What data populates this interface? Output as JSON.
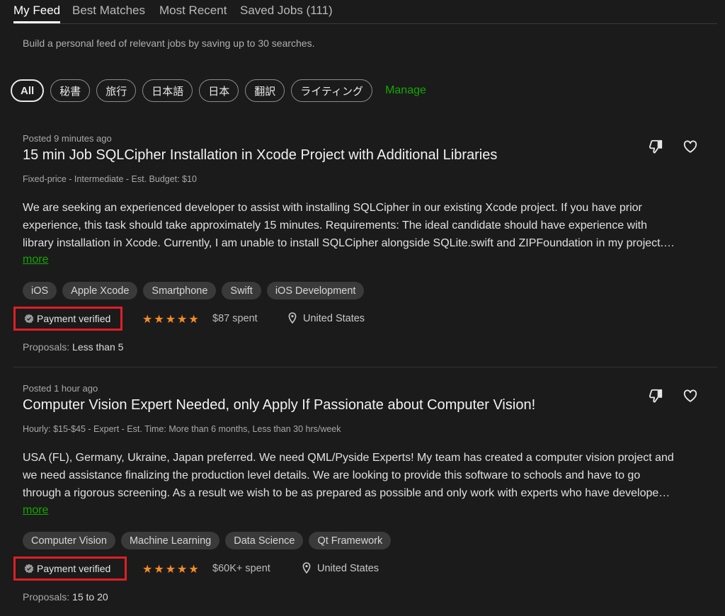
{
  "tabs": [
    {
      "label": "My Feed",
      "active": true
    },
    {
      "label": "Best Matches"
    },
    {
      "label": "Most Recent"
    },
    {
      "label": "Saved Jobs (111)"
    }
  ],
  "feed_hint": "Build a personal feed of relevant jobs by saving up to 30 searches.",
  "filters": {
    "chips": [
      "All",
      "秘書",
      "旅行",
      "日本語",
      "日本",
      "翻訳",
      "ライティング"
    ],
    "manage_label": "Manage"
  },
  "jobs": [
    {
      "posted": "Posted 9 minutes ago",
      "title": "15 min Job SQLCipher Installation in Xcode Project with Additional Libraries",
      "meta": "Fixed-price - Intermediate - Est. Budget: $10",
      "description_lines": [
        "We are seeking an experienced developer to assist with installing SQLCipher in our existing Xcode project. If you have prior",
        "experience, this task should take approximately 15 minutes. Requirements: The ideal candidate should have experience with",
        "library installation in Xcode. Currently, I am unable to install SQLCipher alongside SQLite.swift and ZIPFoundation in my project.…"
      ],
      "more_label": "more",
      "skills": [
        "iOS",
        "Apple Xcode",
        "Smartphone",
        "Swift",
        "iOS Development"
      ],
      "payment": "Payment verified",
      "rating": 5,
      "spent": "$87 spent",
      "location": "United States",
      "proposals_label": "Proposals:",
      "proposals_value": "Less than 5"
    },
    {
      "posted": "Posted 1 hour ago",
      "title": "Computer Vision Expert Needed, only Apply If Passionate about Computer Vision!",
      "meta": "Hourly: $15-$45 - Expert - Est. Time: More than 6 months, Less than 30 hrs/week",
      "description_lines": [
        "USA (FL), Germany, Ukraine, Japan preferred. We need QML/Pyside Experts! My team has created a computer vision project and",
        "we need assistance finalizing the production level details. We are looking to provide this software to schools and have to go",
        "through a rigorous screening. As a result we wish to be as prepared as possible and only work with experts who have develope…"
      ],
      "more_label": "more",
      "skills": [
        "Computer Vision",
        "Machine Learning",
        "Data Science",
        "Qt Framework"
      ],
      "payment": "Payment verified",
      "rating": 5,
      "spent": "$60K+ spent",
      "location": "United States",
      "proposals_label": "Proposals:",
      "proposals_value": "15 to 20"
    }
  ],
  "icons": {
    "dislike": "thumbs-down-icon",
    "save": "heart-icon",
    "verified": "check-badge-icon",
    "location": "map-pin-icon",
    "star": "star-icon"
  },
  "colors": {
    "background": "#1b1b1b",
    "accent_green": "#14a800",
    "star": "#f28c28",
    "highlight_box": "#e01e26"
  }
}
